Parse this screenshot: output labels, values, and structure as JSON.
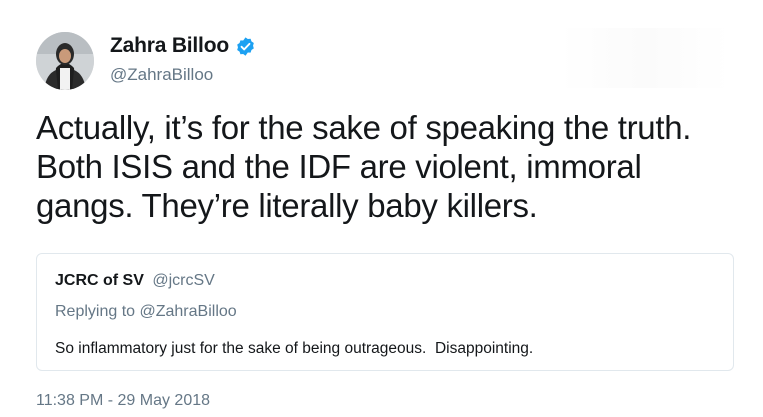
{
  "tweet": {
    "author": {
      "name": "Zahra Billoo",
      "handle": "@ZahraBilloo",
      "verified": true
    },
    "text": "Actually, it’s for the sake of speaking the truth. Both ISIS and the IDF are violent, immoral gangs. They’re literally baby killers.",
    "timestamp": "11:38 PM - 29 May 2018",
    "quoted": {
      "name": "JCRC of SV",
      "handle": "@jcrcSV",
      "replying_to": "Replying to @ZahraBilloo",
      "text": "So inflammatory just for the sake of being outrageous.  Disappointing."
    }
  },
  "colors": {
    "primary_text": "#14171a",
    "secondary_text": "#657786",
    "verified_blue": "#1da1f2",
    "card_border": "#e1e8ed"
  },
  "icons": {
    "verified": "verified-badge-icon",
    "avatar": "author-avatar-image"
  }
}
